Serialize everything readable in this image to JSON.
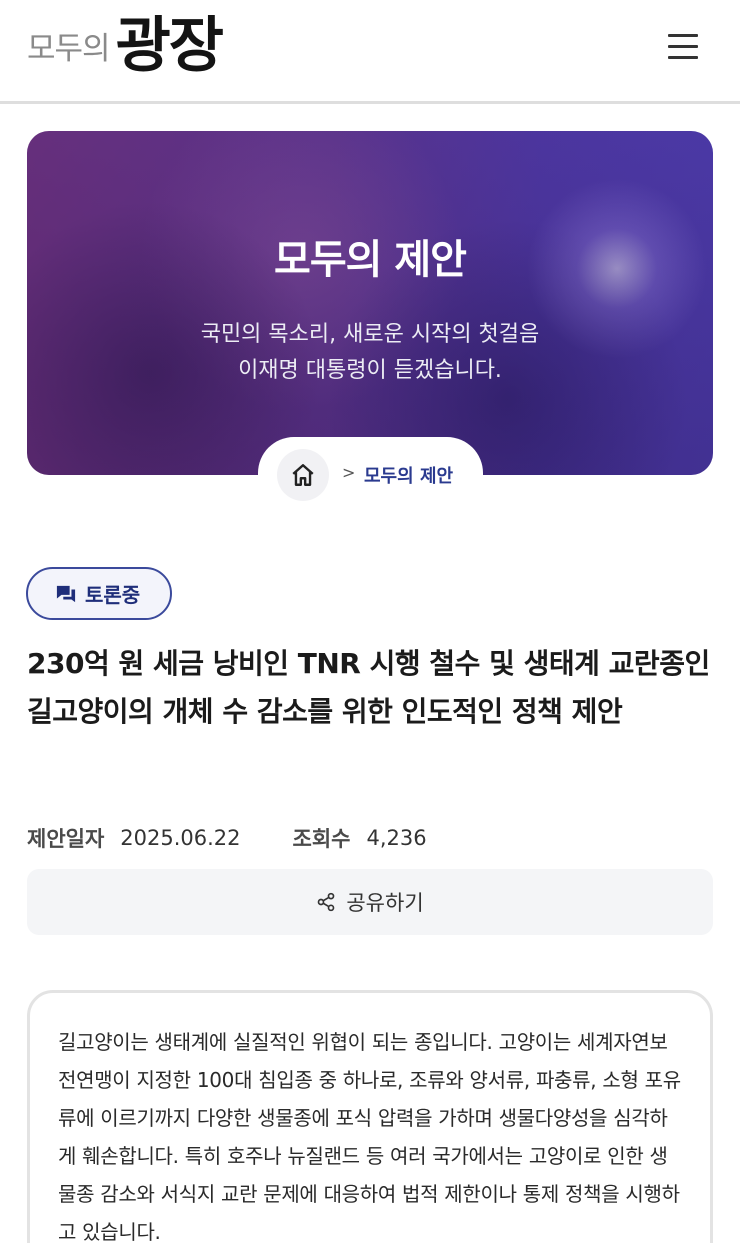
{
  "header": {
    "logo_small": "모두의",
    "logo_big": "광장"
  },
  "hero": {
    "title": "모두의 제안",
    "subtitle_line1": "국민의 목소리, 새로운 시작의 첫걸음",
    "subtitle_line2": "이재명 대통령이 듣겠습니다."
  },
  "breadcrumb": {
    "separator": ">",
    "current": "모두의 제안"
  },
  "proposal": {
    "status": "토론중",
    "title": "230억 원 세금 낭비인 TNR 시행 철수 및 생태계 교란종인 길고양이의 개체 수 감소를 위한 인도적인 정책 제안",
    "date_label": "제안일자",
    "date_value": "2025.06.22",
    "views_label": "조회수",
    "views_value": "4,236",
    "share_label": "공유하기",
    "body": "길고양이는 생태계에 실질적인 위협이 되는 종입니다. 고양이는 세계자연보전연맹이 지정한 100대 침입종 중 하나로, 조류와 양서류, 파충류, 소형 포유류에 이르기까지 다양한 생물종에 포식 압력을 가하며 생물다양성을 심각하게 훼손합니다. 특히 호주나 뉴질랜드 등 여러 국가에서는 고양이로 인한 생물종 감소와 서식지 교란 문제에 대응하여 법적 제한이나 통제 정책을 시행하고 있습니다."
  },
  "icons": {
    "menu": "hamburger-icon",
    "home": "home-icon",
    "status": "chat-icon",
    "share": "share-icon"
  },
  "colors": {
    "accent_navy": "#1f2e7a",
    "logo_pink": "#e03c6c",
    "logo_purple": "#8a2a8c"
  }
}
